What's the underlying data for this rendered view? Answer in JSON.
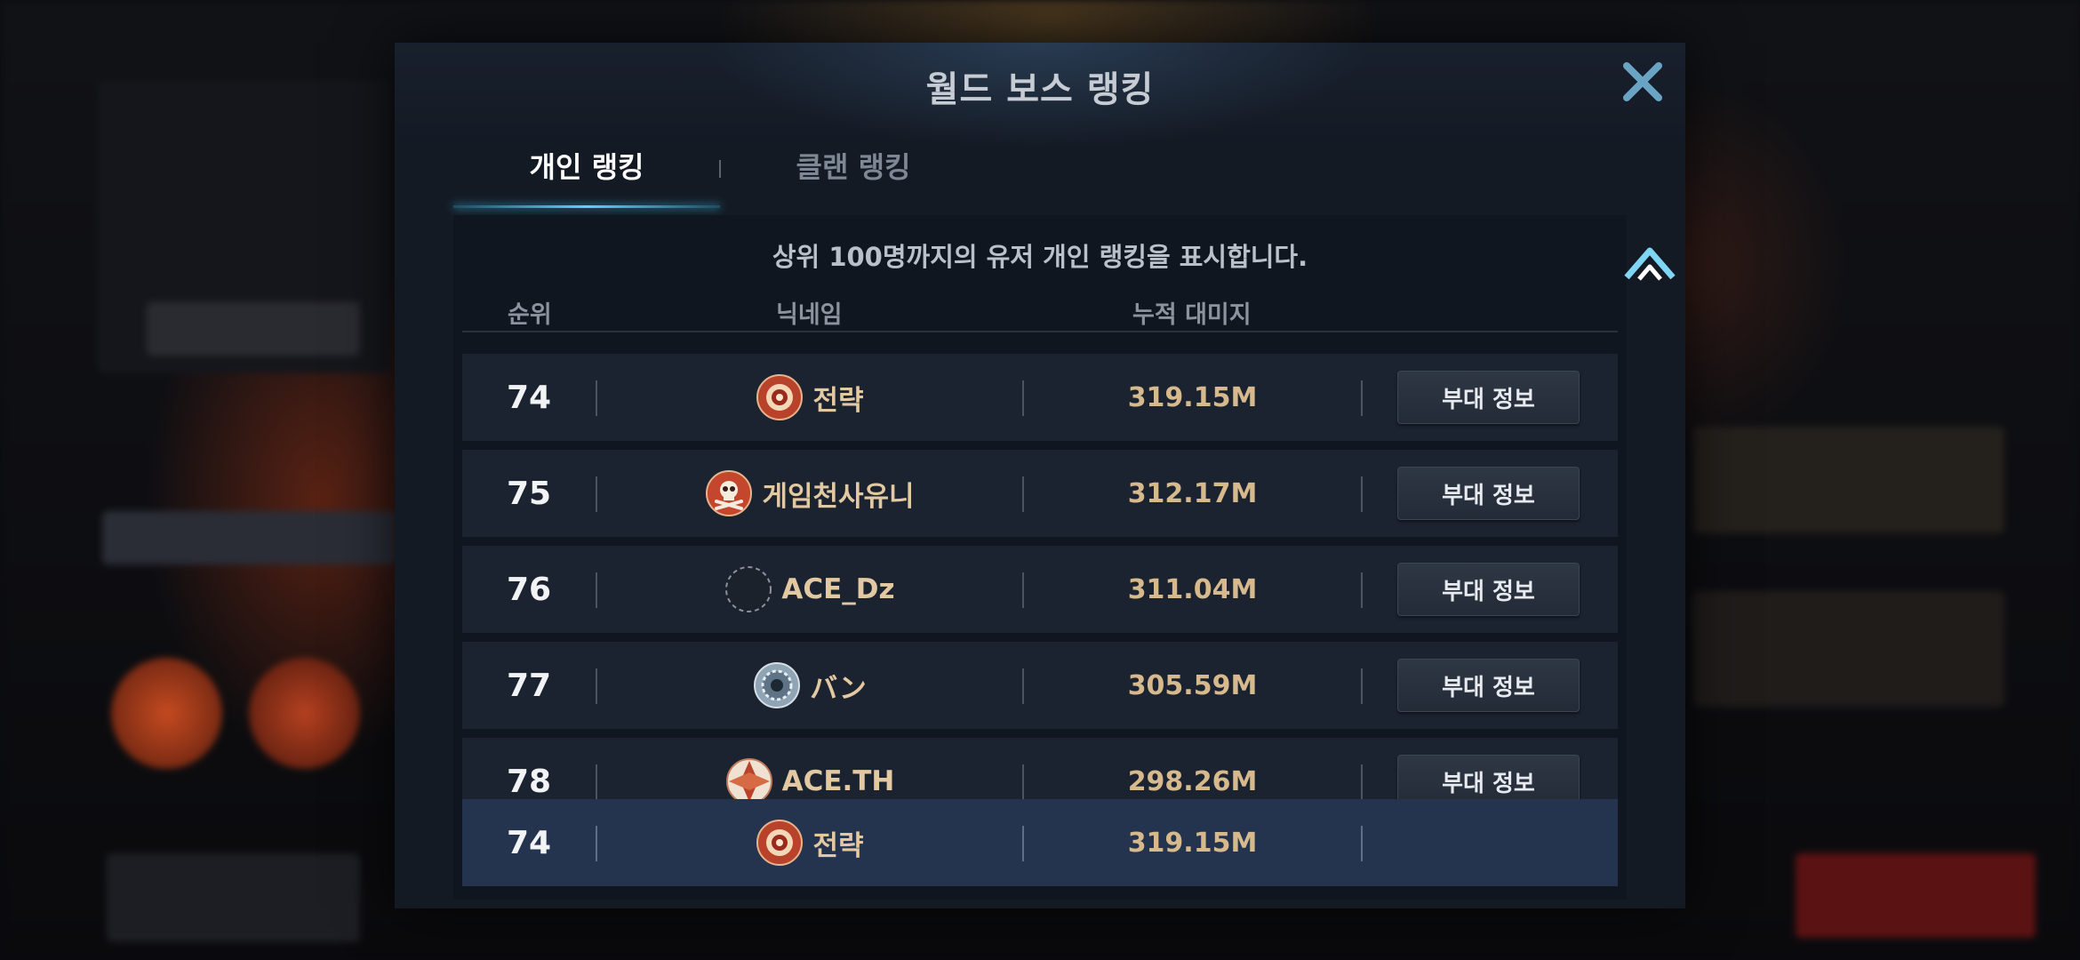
{
  "modal": {
    "title": "월드 보스 랭킹",
    "close_icon": "close-icon"
  },
  "tabs": [
    {
      "label": "개인 랭킹",
      "active": true
    },
    {
      "label": "클랜 랭킹",
      "active": false
    }
  ],
  "panel": {
    "description": "상위 100명까지의 유저 개인 랭킹을 표시합니다.",
    "columns": {
      "rank": "순위",
      "nickname": "닉네임",
      "damage": "누적 대미지"
    }
  },
  "rows": [
    {
      "rank": "74",
      "nickname": "전략",
      "damage": "319.15M",
      "button": "부대 정보",
      "emblem": "sun-emblem-icon"
    },
    {
      "rank": "75",
      "nickname": "게임천사유니",
      "damage": "312.17M",
      "button": "부대 정보",
      "emblem": "skull-emblem-icon"
    },
    {
      "rank": "76",
      "nickname": "ACE_Dz",
      "damage": "311.04M",
      "button": "부대 정보",
      "emblem": "empty-emblem-icon"
    },
    {
      "rank": "77",
      "nickname": "バン",
      "damage": "305.59M",
      "button": "부대 정보",
      "emblem": "gear-emblem-icon"
    },
    {
      "rank": "78",
      "nickname": "ACE.TH",
      "damage": "298.26M",
      "button": "부대 정보",
      "emblem": "cross-emblem-icon"
    }
  ],
  "my_rank": {
    "rank": "74",
    "nickname": "전략",
    "damage": "319.15M",
    "emblem": "sun-emblem-icon"
  },
  "colors": {
    "accent_tab": "#5fd3f5",
    "name_gold": "#e3c9a1",
    "my_row_bg": "#24334e"
  },
  "scroll_icon": "chevron-up-icon"
}
